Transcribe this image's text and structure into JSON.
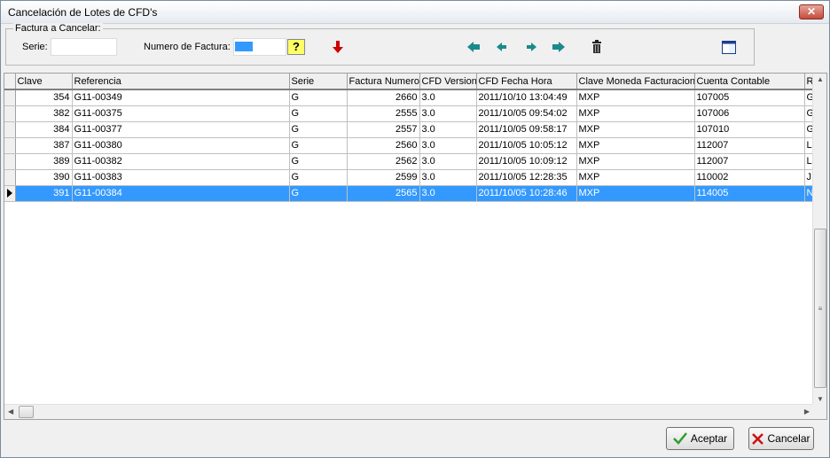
{
  "window": {
    "title": "Cancelación de Lotes de CFD's",
    "close_glyph": "✕"
  },
  "filter": {
    "group_label": "Factura a Cancelar:",
    "serie_label": "Serie:",
    "serie_value": "",
    "numero_label": "Numero de Factura:",
    "numero_value": "",
    "help_glyph": "?"
  },
  "toolbar": {
    "icons": [
      "help-icon",
      "down-arrow-icon",
      "first-icon",
      "prev-icon",
      "next-icon",
      "last-icon",
      "trash-icon",
      "panel-icon"
    ],
    "colors": {
      "accent": "#3399ff",
      "arrow_red": "#cc0000",
      "nav_teal": "#1b8a8a"
    }
  },
  "grid": {
    "columns": [
      "Clave",
      "Referencia",
      "Serie",
      "Factura Numero",
      "CFD Version",
      "CFD Fecha Hora",
      "Clave Moneda Facturacion",
      "Cuenta Contable",
      "R"
    ],
    "rows": [
      [
        "354",
        "G11-00349",
        "G",
        "2660",
        "3.0",
        "2011/10/10 13:04:49",
        "MXP",
        "107005",
        "G"
      ],
      [
        "382",
        "G11-00375",
        "G",
        "2555",
        "3.0",
        "2011/10/05 09:54:02",
        "MXP",
        "107006",
        "G"
      ],
      [
        "384",
        "G11-00377",
        "G",
        "2557",
        "3.0",
        "2011/10/05 09:58:17",
        "MXP",
        "107010",
        "G"
      ],
      [
        "387",
        "G11-00380",
        "G",
        "2560",
        "3.0",
        "2011/10/05 10:05:12",
        "MXP",
        "112007",
        "L"
      ],
      [
        "389",
        "G11-00382",
        "G",
        "2562",
        "3.0",
        "2011/10/05 10:09:12",
        "MXP",
        "112007",
        "L"
      ],
      [
        "390",
        "G11-00383",
        "G",
        "2599",
        "3.0",
        "2011/10/05 12:28:35",
        "MXP",
        "110002",
        "J"
      ],
      [
        "391",
        "G11-00384",
        "G",
        "2565",
        "3.0",
        "2011/10/05 10:28:46",
        "MXP",
        "114005",
        "N"
      ]
    ],
    "selected_index": 6
  },
  "buttons": {
    "accept_label": "Aceptar",
    "cancel_label": "Cancelar"
  }
}
